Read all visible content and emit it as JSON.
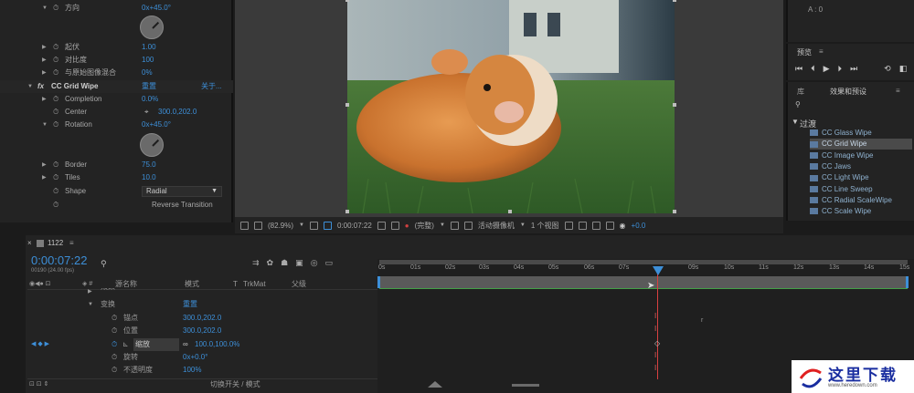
{
  "effect_controls": {
    "direction": {
      "label": "方向",
      "value": "0x+45.0°"
    },
    "undulation": {
      "label": "起伏",
      "value": "1.00"
    },
    "contrast": {
      "label": "对比度",
      "value": "100"
    },
    "blend": {
      "label": "与原始图像混合",
      "value": "0%"
    },
    "effect": {
      "fx": "fx",
      "name": "CC Grid Wipe",
      "reset": "重置",
      "about": "关于..."
    },
    "completion": {
      "label": "Completion",
      "value": "0.0%"
    },
    "center": {
      "label": "Center",
      "value": "300.0,202.0"
    },
    "rotation": {
      "label": "Rotation",
      "value": "0x+45.0°"
    },
    "border": {
      "label": "Border",
      "value": "75.0"
    },
    "tiles": {
      "label": "Tiles",
      "value": "10.0"
    },
    "shape": {
      "label": "Shape",
      "value": "Radial"
    },
    "reverse": {
      "label": "Reverse Transition"
    }
  },
  "viewer_toolbar": {
    "zoom": "(82.9%)",
    "timecode": "0:00:07:22",
    "quality": "(完整)",
    "camera": "活动摄像机",
    "views": "1 个视图",
    "exposure": "+0.0"
  },
  "right_panels": {
    "info": "A : 0",
    "preview_tab": "预览",
    "library_tab": "库",
    "effects_tab": "效果和预设",
    "category": "过渡",
    "effects": [
      "CC Glass Wipe",
      "CC Grid Wipe",
      "CC Image Wipe",
      "CC Jaws",
      "CC Light Wipe",
      "CC Line Sweep",
      "CC Radial ScaleWipe",
      "CC Scale Wipe"
    ],
    "selected_effect": "CC Grid Wipe"
  },
  "timeline": {
    "comp_name": "1122",
    "timecode": "0:00:07:22",
    "frames": "00190 (24.00 fps)",
    "columns": {
      "source": "源名称",
      "mode": "模式",
      "t": "T",
      "trkmat": "TrkMat",
      "parent": "父级"
    },
    "ruler": [
      "0s",
      "01s",
      "02s",
      "03s",
      "04s",
      "05s",
      "06s",
      "07s",
      "09s",
      "10s",
      "11s",
      "12s",
      "13s",
      "14s",
      "15s"
    ],
    "rows": {
      "effects_partial": "效果",
      "transform": "变换",
      "transform_reset": "重置",
      "anchor": {
        "label": "锚点",
        "value": "300.0,202.0"
      },
      "position": {
        "label": "位置",
        "value": "300.0,202.0"
      },
      "scale": {
        "label": "缩放",
        "value": "100.0,100.0%"
      },
      "rotation": {
        "label": "旋转",
        "value": "0x+0.0°"
      },
      "opacity": {
        "label": "不透明度",
        "value": "100%"
      }
    },
    "footer": "切换开关 / 模式"
  },
  "watermark": {
    "text": "这里下载",
    "url": "www.heredown.com"
  }
}
